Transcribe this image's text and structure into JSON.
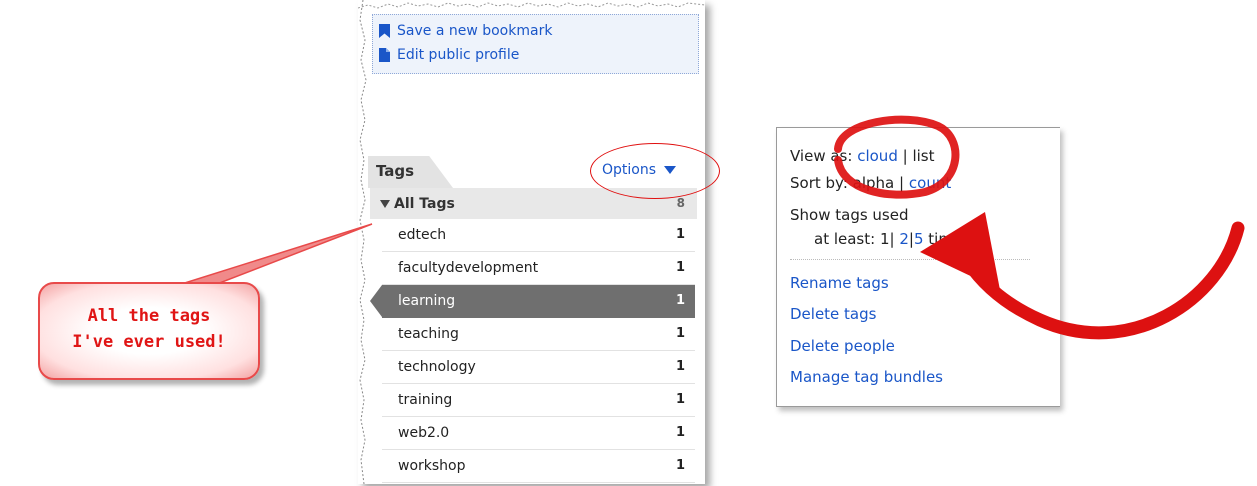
{
  "actions": {
    "save_bookmark": "Save a new bookmark",
    "edit_profile": "Edit public profile"
  },
  "tags_panel": {
    "tab_label": "Tags",
    "options_label": "Options",
    "all_tags_label": "All Tags",
    "all_tags_count": "8",
    "tags": [
      {
        "name": "edtech",
        "count": "1"
      },
      {
        "name": "facultydevelopment",
        "count": "1"
      },
      {
        "name": "learning",
        "count": "1"
      },
      {
        "name": "teaching",
        "count": "1"
      },
      {
        "name": "technology",
        "count": "1"
      },
      {
        "name": "training",
        "count": "1"
      },
      {
        "name": "web2.0",
        "count": "1"
      },
      {
        "name": "workshop",
        "count": "1"
      }
    ],
    "selected_tag": "learning"
  },
  "callout": {
    "line1": "All the tags",
    "line2": "I've ever used!"
  },
  "options_popup": {
    "view_as_label": "View as:",
    "view_cloud": "cloud",
    "view_list": "list",
    "sort_by_label": "Sort by:",
    "sort_alpha": "alpha",
    "sort_count": "count",
    "show_tags_label": "Show tags used",
    "at_least_label": "at least:",
    "threshold_1": "1",
    "threshold_2": "2",
    "threshold_5": "5",
    "times_label": "times",
    "separator": "|",
    "menu": {
      "rename": "Rename tags",
      "delete_tags": "Delete tags",
      "delete_people": "Delete people",
      "manage_bundles": "Manage tag bundles"
    }
  },
  "colors": {
    "link": "#1a56c8",
    "annotation_red": "#e01010",
    "selected_row": "#6f6f6f"
  }
}
